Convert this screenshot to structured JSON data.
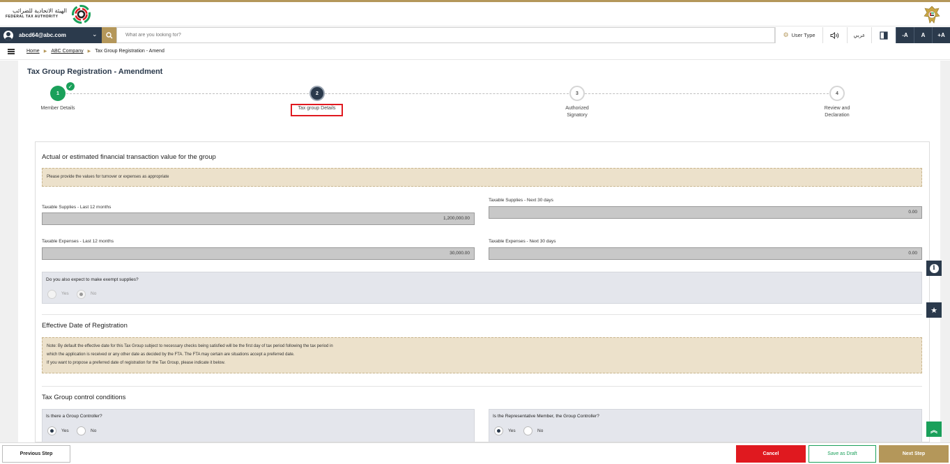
{
  "header": {
    "logo_ar": "الهيئة الاتحادية للضرائب",
    "logo_en": "FEDERAL TAX AUTHORITY"
  },
  "toolbar": {
    "user_email": "abcd64@abc.com",
    "search_placeholder": "What are you looking for?",
    "user_type_label": "User Type",
    "arabic_label": "عربي",
    "font_decrease": "-A",
    "font_normal": "A",
    "font_increase": "+A"
  },
  "breadcrumb": {
    "home": "Home",
    "company": "ABC Company",
    "current": "Tax Group Registration - Amend"
  },
  "page": {
    "title": "Tax Group Registration - Amendment"
  },
  "stepper": {
    "steps": [
      {
        "number": "1",
        "label": "Member Details",
        "status": "completed"
      },
      {
        "number": "2",
        "label": "Tax group Details",
        "status": "current"
      },
      {
        "number": "3",
        "label_line1": "Authorized",
        "label_line2": "Signatory",
        "status": "pending"
      },
      {
        "number": "4",
        "label_line1": "Review and",
        "label_line2": "Declaration",
        "status": "pending"
      }
    ]
  },
  "financial": {
    "title": "Actual or estimated financial transaction value for the group",
    "notice": "Please provide the values for turnover or expenses as appropriate",
    "supplies_last_label": "Taxable Supplies - Last 12 months",
    "supplies_last_value": "1,200,000.00",
    "supplies_next_label": "Taxable Supplies - Next 30 days",
    "supplies_next_value": "0.00",
    "expenses_last_label": "Taxable Expenses - Last 12 months",
    "expenses_last_value": "30,000.00",
    "expenses_next_label": "Taxable Expenses - Next 30 days",
    "expenses_next_value": "0.00",
    "exempt_question": "Do you also expect to make exempt supplies?",
    "exempt_yes": "Yes",
    "exempt_no": "No",
    "exempt_selected": "No"
  },
  "effective_date": {
    "title": "Effective Date of Registration",
    "note_line1": "Note: By default the effective date for this Tax Group subject to necessary checks being satisfied will be the first day of tax period following the tax period in",
    "note_line2": "which the application is received or any other date as decided by the FTA. The FTA may certain are situations accept a preferred date.",
    "note_line3": "If you want to propose a preferred date of registration for the Tax Group, please indicate it below."
  },
  "control": {
    "title": "Tax Group control conditions",
    "q1": "Is there a Group Controller?",
    "q1_yes": "Yes",
    "q1_no": "No",
    "q1_selected": "Yes",
    "q2": "Is the Representative Member, the Group Controller?",
    "q2_yes": "Yes",
    "q2_no": "No",
    "q2_selected": "Yes"
  },
  "footer": {
    "previous": "Previous Step",
    "cancel": "Cancel",
    "save_draft": "Save as Draft",
    "next": "Next Step"
  },
  "colors": {
    "navy": "#2b3a4c",
    "gold": "#b4975a",
    "green": "#1aa05a",
    "red": "#e0191f",
    "notice_bg": "#ece1cb"
  }
}
